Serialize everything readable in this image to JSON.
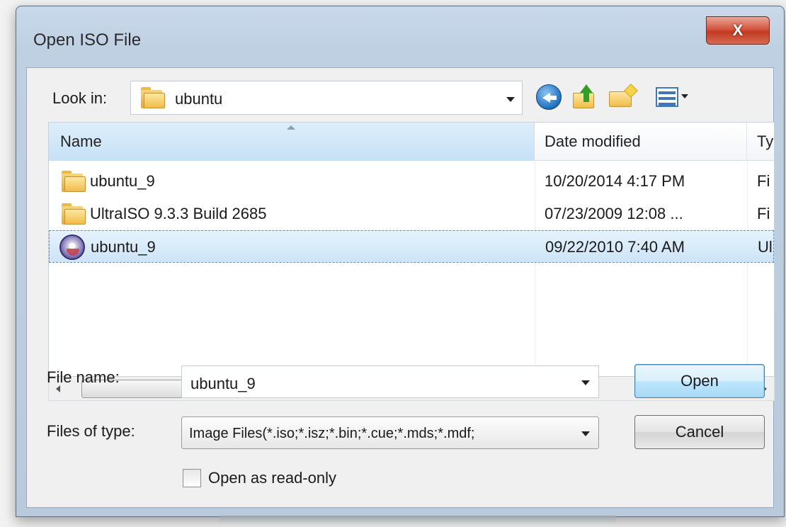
{
  "window": {
    "title": "Open ISO File",
    "close_label": "X"
  },
  "toolbar": {
    "look_in_label": "Look in:",
    "look_in_value": "ubuntu",
    "icons": [
      "back-icon",
      "up-folder-icon",
      "new-folder-icon",
      "views-menu-icon"
    ]
  },
  "file_list": {
    "columns": [
      "Name",
      "Date modified",
      "Ty"
    ],
    "rows": [
      {
        "icon": "folder-icon",
        "name": "ubuntu_9",
        "date": "10/20/2014 4:17 PM",
        "type": "Fi",
        "selected": false
      },
      {
        "icon": "folder-icon",
        "name": "UltraISO 9.3.3 Build 2685",
        "date": "07/23/2009 12:08 ...",
        "type": "Fi",
        "selected": false
      },
      {
        "icon": "disc-image-icon",
        "name": "ubuntu_9",
        "date": "09/22/2010 7:40 AM",
        "type": "Ul",
        "selected": true
      }
    ],
    "scroll_thumb_grip": "III"
  },
  "form": {
    "file_name_label": "File name:",
    "file_name_value": "ubuntu_9",
    "file_type_label": "Files of type:",
    "file_type_value": "Image Files(*.iso;*.isz;*.bin;*.cue;*.mds;*.mdf;",
    "read_only_label": "Open as read-only",
    "read_only_checked": false
  },
  "buttons": {
    "open": "Open",
    "cancel": "Cancel"
  },
  "colors": {
    "selection": "#cde4f7",
    "close_button": "#c23b22",
    "title_bar": "#c9d9ea"
  }
}
